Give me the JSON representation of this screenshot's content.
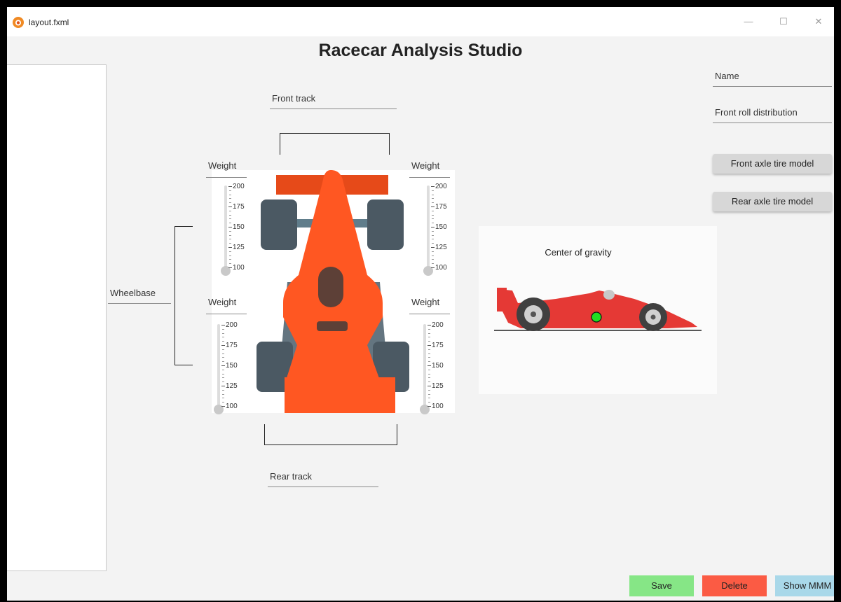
{
  "window": {
    "title": "layout.fxml",
    "controls": {
      "minimize": "—",
      "maximize": "☐",
      "close": "✕"
    }
  },
  "app": {
    "heading": "Racecar Analysis Studio"
  },
  "fields": {
    "front_track": "Front track",
    "rear_track": "Rear track",
    "wheelbase": "Wheelbase",
    "name": "Name",
    "front_roll_distribution": "Front roll distribution"
  },
  "sliders": [
    {
      "label": "Weight",
      "corner": "front-left",
      "min": 100,
      "max": 200,
      "value": 100,
      "ticks": [
        "200",
        "175",
        "150",
        "125",
        "100"
      ]
    },
    {
      "label": "Weight",
      "corner": "front-right",
      "min": 100,
      "max": 200,
      "value": 100,
      "ticks": [
        "200",
        "175",
        "150",
        "125",
        "100"
      ]
    },
    {
      "label": "Weight",
      "corner": "rear-left",
      "min": 100,
      "max": 200,
      "value": 100,
      "ticks": [
        "200",
        "175",
        "150",
        "125",
        "100"
      ]
    },
    {
      "label": "Weight",
      "corner": "rear-right",
      "min": 100,
      "max": 200,
      "value": 100,
      "ticks": [
        "200",
        "175",
        "150",
        "125",
        "100"
      ]
    }
  ],
  "cog": {
    "title": "Center of gravity",
    "marker_color": "#22dd22"
  },
  "buttons": {
    "front_tire": "Front axle tire model",
    "rear_tire": "Rear axle tire model",
    "save": "Save",
    "delete": "Delete",
    "show_mmm": "Show MMM"
  },
  "colors": {
    "save": "#86e686",
    "delete": "#fb5b44",
    "show_mmm": "#a9d8e9",
    "car_body": "#ff5722",
    "car_wing": "#e64a19",
    "tire": "#4b5963",
    "side_car": "#e53935"
  }
}
